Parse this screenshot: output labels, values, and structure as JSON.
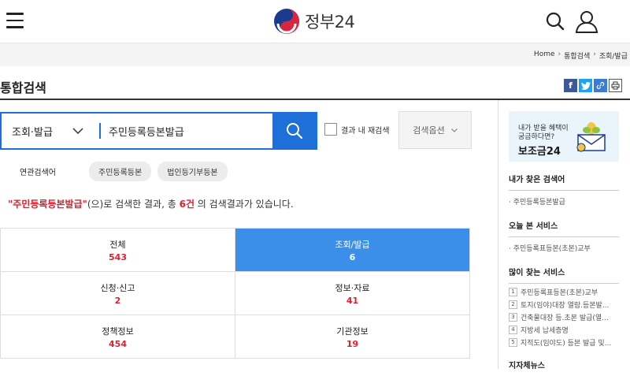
{
  "header": {
    "logo_text": "정부24"
  },
  "breadcrumb": [
    "Home",
    "통합검색",
    "조회/발급"
  ],
  "page_title": "통합검색",
  "search": {
    "scope": "조회·발급",
    "query": "주민등록등본발급",
    "recheck_label": "결과 내 재검색",
    "options_label": "검색옵션"
  },
  "related": {
    "label": "연관검색어",
    "chips": [
      "주민등록등본",
      "법인등기부등본"
    ]
  },
  "summary": {
    "query": "\"주민등록등본발급\"",
    "text1": "(으)로 검색한 결과, 총 ",
    "count": "6건",
    "text2": " 의 검색결과가 있습니다."
  },
  "categories": [
    {
      "name": "전체",
      "count": "543",
      "active": false
    },
    {
      "name": "조회/발급",
      "count": "6",
      "active": true
    },
    {
      "name": "신청·신고",
      "count": "2",
      "active": false
    },
    {
      "name": "정보·자료",
      "count": "41",
      "active": false
    },
    {
      "name": "정책정보",
      "count": "454",
      "active": false
    },
    {
      "name": "기관정보",
      "count": "19",
      "active": false
    }
  ],
  "sidebar": {
    "banner": {
      "line1": "내가 받을 혜택이",
      "line2": "궁금하다면?",
      "line3": "보조금24"
    },
    "my_search": {
      "title": "내가 찾은 검색어",
      "items": [
        "· 주민등록등본발급"
      ]
    },
    "today": {
      "title": "오늘 본 서비스",
      "items": [
        "· 주민등록표등본(초본)교부"
      ]
    },
    "popular": {
      "title": "많이 찾는 서비스",
      "items": [
        {
          "num": "1",
          "text": "주민등록표등본(초본)교부"
        },
        {
          "num": "2",
          "text": "토지(임야)대장 열람.등본발..."
        },
        {
          "num": "3",
          "text": "건축물대장 등.초본 발급(열..."
        },
        {
          "num": "4",
          "text": "지방세 납세증명"
        },
        {
          "num": "5",
          "text": "지적도(임야도) 등본 발급 및..."
        }
      ]
    },
    "local_news": {
      "title": "지자체뉴스"
    }
  },
  "colors": {
    "primary": "#1f6fd8",
    "active_tab": "#3b8fe8",
    "count_red": "#e0202f"
  }
}
